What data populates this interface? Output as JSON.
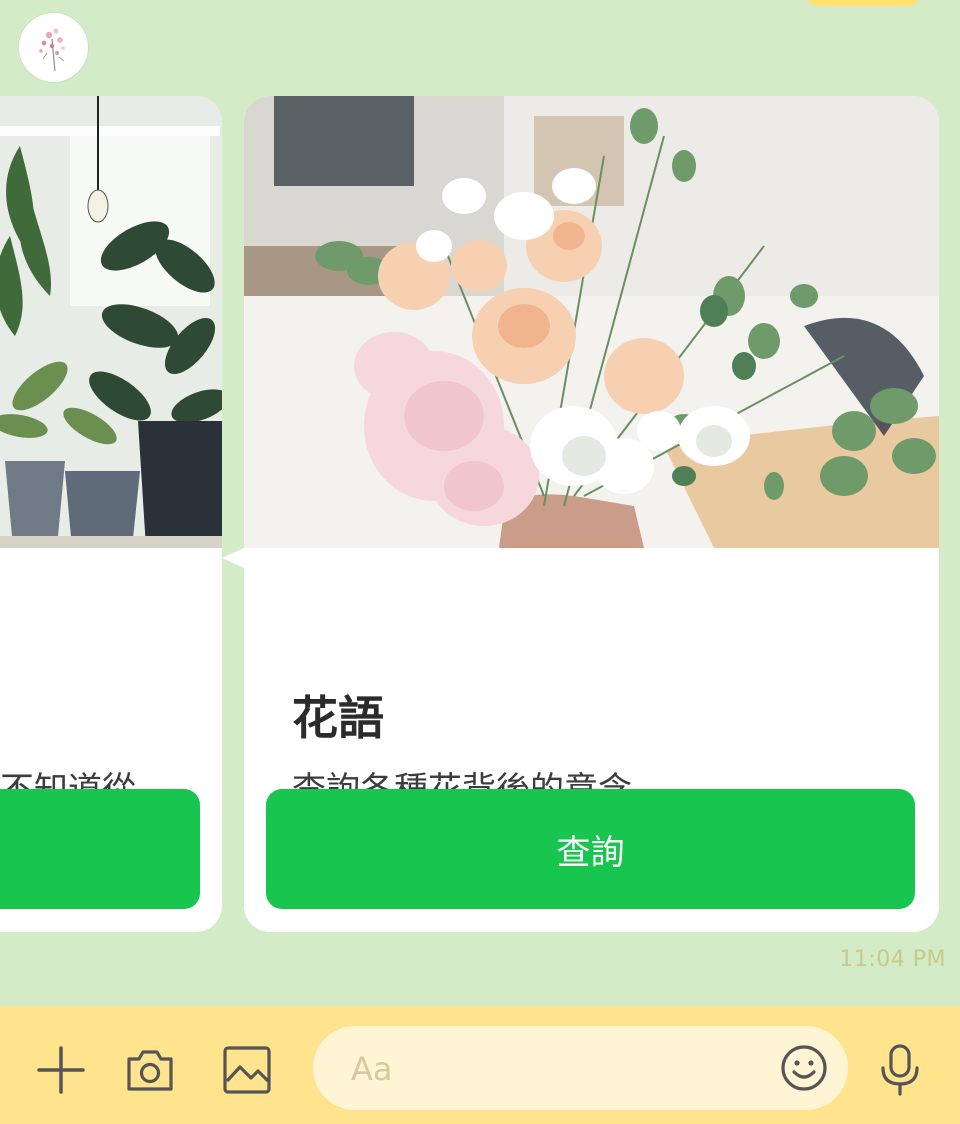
{
  "chat": {
    "timestamp": "11:04 PM"
  },
  "cards": [
    {
      "description": "不知道從",
      "button_label": ""
    },
    {
      "title": "花語",
      "description": "查詢各種花背後的意含",
      "button_label": "查詢"
    }
  ],
  "input_bar": {
    "placeholder": "Aa",
    "icons": [
      "plus-icon",
      "camera-icon",
      "image-icon",
      "emoji-icon",
      "microphone-icon"
    ]
  },
  "colors": {
    "chat_background": "#d3ebc6",
    "button_green": "#17c54f",
    "input_bar": "#ffe38d",
    "input_field": "#fff4d4"
  }
}
